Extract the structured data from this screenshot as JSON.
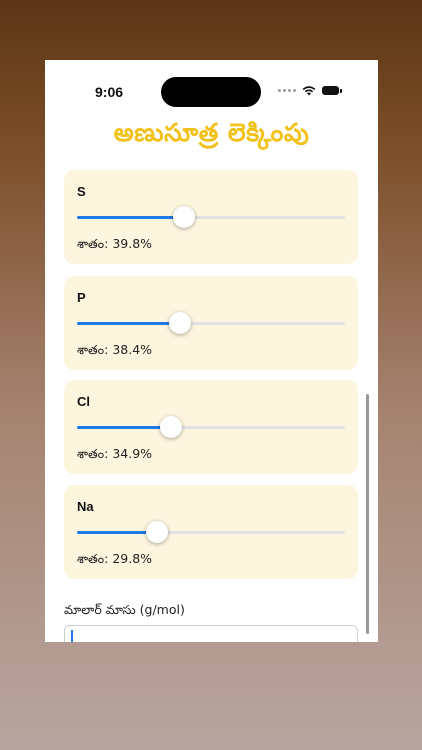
{
  "status_bar": {
    "time": "9:06"
  },
  "app": {
    "title": "అణుసూత్ర లెక్కింపు"
  },
  "elements": [
    {
      "symbol": "S",
      "percent_label": "శాతం:",
      "percent_text": "39.8%",
      "fraction": 0.398
    },
    {
      "symbol": "P",
      "percent_label": "శాతం:",
      "percent_text": "38.4%",
      "fraction": 0.384
    },
    {
      "symbol": "Cl",
      "percent_label": "శాతం:",
      "percent_text": "34.9%",
      "fraction": 0.349
    },
    {
      "symbol": "Na",
      "percent_label": "శాతం:",
      "percent_text": "29.8%",
      "fraction": 0.298
    }
  ],
  "molar_mass": {
    "label": "మాలార్ మాసు (g/mol)",
    "value": ""
  },
  "colors": {
    "accent": "#1f7ae6",
    "title": "#f2c11a",
    "card": "#fdf6df"
  }
}
